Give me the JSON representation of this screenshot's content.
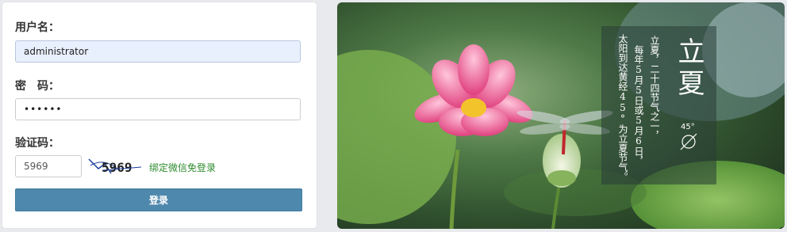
{
  "form": {
    "username_label": "用户名：",
    "username_value": "administrator",
    "password_label": "密　码：",
    "password_value": "••••••",
    "captcha_label": "验证码：",
    "captcha_value": "5969",
    "captcha_image_text": "5969",
    "wechat_link": "绑定微信免登录",
    "login_button": "登录"
  },
  "banner": {
    "term_title": "立夏",
    "term_description": "立夏，二十四节气之一，每年5月5日或5月6日，太阳到达黄经45°为立夏节气。",
    "col1": "立夏，二十四节气之一，",
    "col2": "每年5月5日或5月6日，",
    "col3": "太阳到达黄经45°为立夏节气。",
    "degree_label": "45°"
  },
  "colors": {
    "login_button": "#4f88ad",
    "link_green": "#2e8b2e",
    "input_filled_bg": "#e8f0fe"
  }
}
